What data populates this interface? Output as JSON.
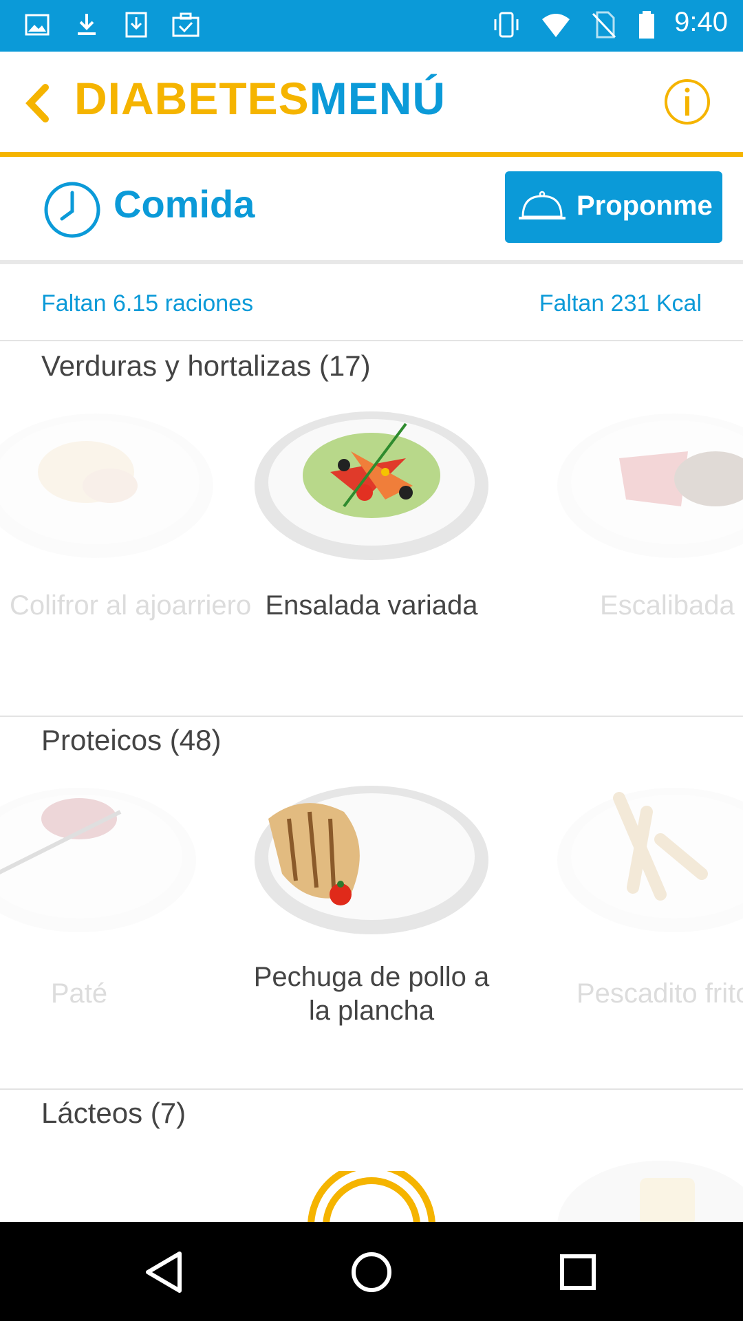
{
  "status_bar": {
    "time": "9:40",
    "icons": [
      "image-icon",
      "download-icon",
      "download-box-icon",
      "briefcase-check-icon",
      "vibrate-icon",
      "wifi-icon",
      "no-sim-icon",
      "battery-icon"
    ]
  },
  "app_bar": {
    "logo_part1": "DIABETES",
    "logo_part2": "MENÚ"
  },
  "meal": {
    "title": "Comida",
    "propose_label": "Proponme"
  },
  "summary": {
    "rations": "Faltan 6.15 raciones",
    "kcal": "Faltan 231 Kcal"
  },
  "sections": [
    {
      "title": "Verduras y hortalizas (17)",
      "items": [
        {
          "name": "Colifror al ajoarriero"
        },
        {
          "name": "Ensalada variada"
        },
        {
          "name": "Escalibada"
        }
      ]
    },
    {
      "title": "Proteicos (48)",
      "items": [
        {
          "name": "Paté"
        },
        {
          "name": "Pechuga de pollo a la plancha"
        },
        {
          "name": "Pescadito frito"
        }
      ]
    },
    {
      "title": "Lácteos (7)",
      "items": []
    }
  ],
  "colors": {
    "accent_blue": "#0b9ad8",
    "accent_yellow": "#f5b400"
  }
}
